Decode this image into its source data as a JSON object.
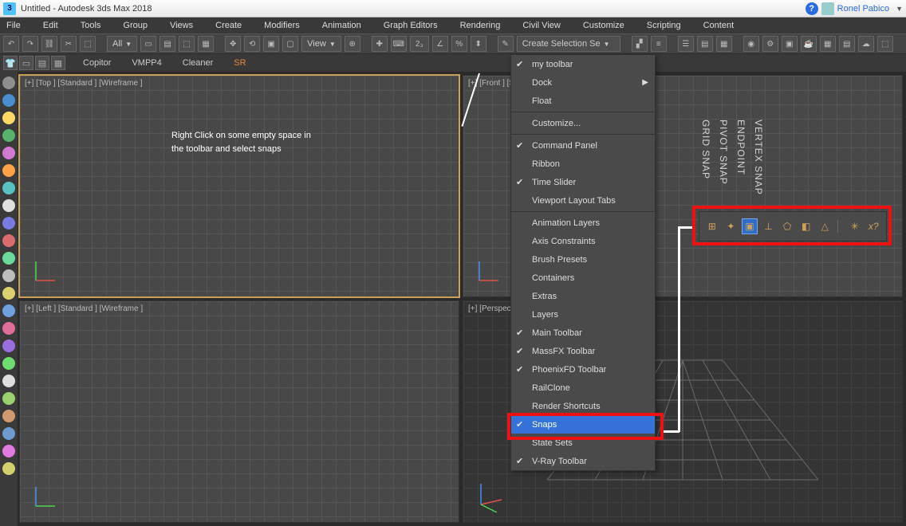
{
  "titlebar": {
    "app_icon_text": "3",
    "title": "Untitled - Autodesk 3ds Max 2018",
    "user_name": "Ronel Pabico"
  },
  "menubar": [
    "File",
    "Edit",
    "Tools",
    "Group",
    "Views",
    "Create",
    "Modifiers",
    "Animation",
    "Graph Editors",
    "Rendering",
    "Civil View",
    "Customize",
    "Scripting",
    "Content"
  ],
  "toolbar1": {
    "filter_select": "All",
    "view_select": "View",
    "selection_select": "Create Selection Se"
  },
  "toolbar2": {
    "copitor": "Copitor",
    "vmpp4": "VMPP4",
    "cleaner": "Cleaner",
    "sr": "SR"
  },
  "viewports": {
    "top": "[+] [Top ] [Standard ] [Wireframe ]",
    "front": "[+] [Front ] [S",
    "left": "[+] [Left ] [Standard ] [Wireframe ]",
    "persp": "[+] [Perspecti"
  },
  "context_menu": [
    {
      "label": "my toolbar",
      "checked": true
    },
    {
      "label": "Dock",
      "submenu": true
    },
    {
      "label": "Float"
    },
    {
      "sep": true
    },
    {
      "label": "Customize..."
    },
    {
      "sep": true
    },
    {
      "label": "Command Panel",
      "checked": true
    },
    {
      "label": "Ribbon"
    },
    {
      "label": "Time Slider",
      "checked": true
    },
    {
      "label": "Viewport Layout Tabs"
    },
    {
      "sep": true
    },
    {
      "label": "Animation Layers"
    },
    {
      "label": "Axis Constraints"
    },
    {
      "label": "Brush Presets"
    },
    {
      "label": "Containers"
    },
    {
      "label": "Extras"
    },
    {
      "label": "Layers"
    },
    {
      "label": "Main Toolbar",
      "checked": true
    },
    {
      "label": "MassFX Toolbar",
      "checked": true
    },
    {
      "label": "PhoenixFD Toolbar",
      "checked": true
    },
    {
      "label": "RailClone"
    },
    {
      "label": "Render Shortcuts"
    },
    {
      "label": "Snaps",
      "checked": true,
      "selected": true
    },
    {
      "label": "State Sets"
    },
    {
      "label": "V-Ray Toolbar",
      "checked": true
    }
  ],
  "annotation": {
    "line1": "Right Click on some empty space in",
    "line2": "the toolbar and select snaps"
  },
  "snap_labels": [
    "GRID SNAP",
    "PIVOT SNAP",
    "ENDPOINT",
    "VERTEX SNAP"
  ],
  "rail_colors": [
    "#8e8e8e",
    "#4a8ed0",
    "#ffd966",
    "#57b26d",
    "#d07ad0",
    "#ffa24a",
    "#5ac1c1",
    "#e0e0e0",
    "#7a7ae0",
    "#d96c6c",
    "#6cd99a",
    "#bdbdbd",
    "#decf6e",
    "#6ea1de",
    "#de6e9a",
    "#9a6ede",
    "#6ede6e",
    "#dedede",
    "#9ad06e",
    "#d09a6e",
    "#6e9ad0",
    "#e07ae0",
    "#d0d06e"
  ]
}
